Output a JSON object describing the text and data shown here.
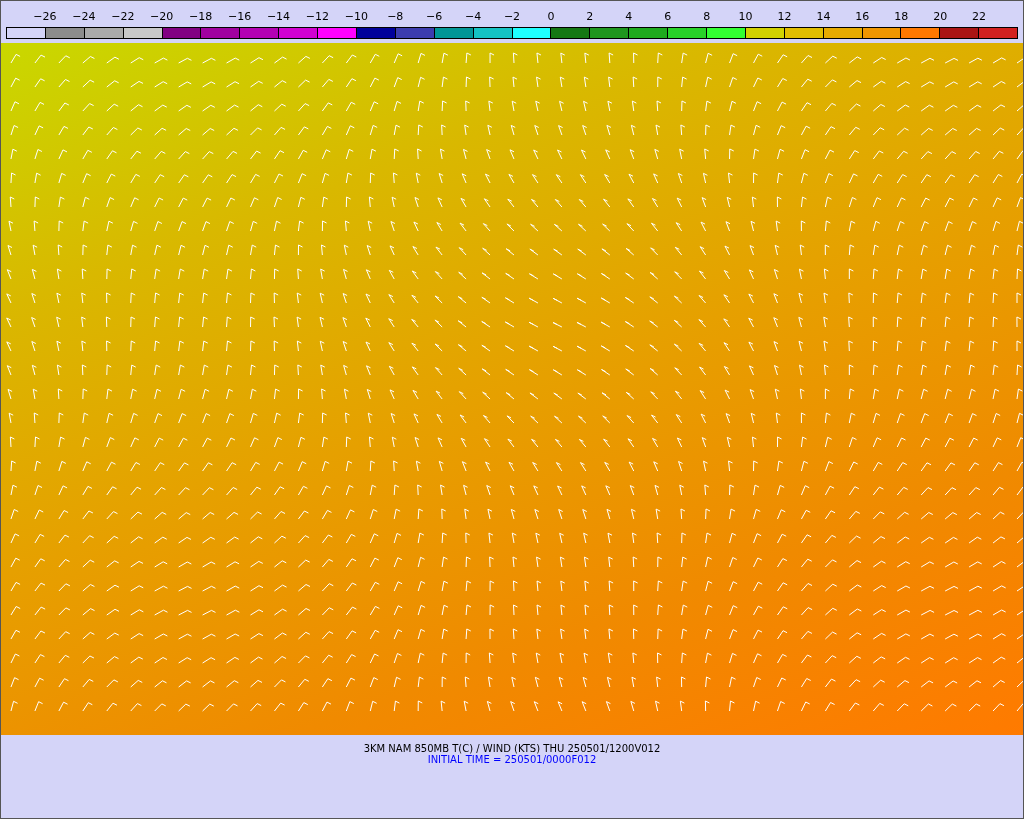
{
  "colorbar": {
    "labels": [
      "−26",
      "−24",
      "−22",
      "−20",
      "−18",
      "−16",
      "−14",
      "−12",
      "−10",
      "−8",
      "−6",
      "−4",
      "−2",
      "0",
      "2",
      "4",
      "6",
      "8",
      "10",
      "12",
      "14",
      "16",
      "18",
      "20",
      "22"
    ],
    "boxes": [
      {
        "color": "#d4d4f8"
      },
      {
        "color": "#8c8c8c"
      },
      {
        "color": "#aaaaaa"
      },
      {
        "color": "#c8c8c8"
      },
      {
        "color": "#820082"
      },
      {
        "color": "#a000a0"
      },
      {
        "color": "#b400b4"
      },
      {
        "color": "#d200d2"
      },
      {
        "color": "#ff00ff"
      },
      {
        "color": "#00009b"
      },
      {
        "color": "#3c3caf"
      },
      {
        "color": "#009696"
      },
      {
        "color": "#14c3c3"
      },
      {
        "color": "#1effff"
      },
      {
        "color": "#147814"
      },
      {
        "color": "#1e961e"
      },
      {
        "color": "#1eaa1e"
      },
      {
        "color": "#28d228"
      },
      {
        "color": "#32ff32"
      },
      {
        "color": "#d2d200"
      },
      {
        "color": "#e1be00"
      },
      {
        "color": "#e6aa00"
      },
      {
        "color": "#f09600"
      },
      {
        "color": "#ff7800"
      },
      {
        "color": "#aa1414"
      },
      {
        "color": "#d22020"
      }
    ]
  },
  "caption": {
    "title": "3KM NAM 850MB T(C) / WIND (KTS) THU 250501/1200V012",
    "initial_time": "INITIAL TIME = 250501/0000F012"
  }
}
